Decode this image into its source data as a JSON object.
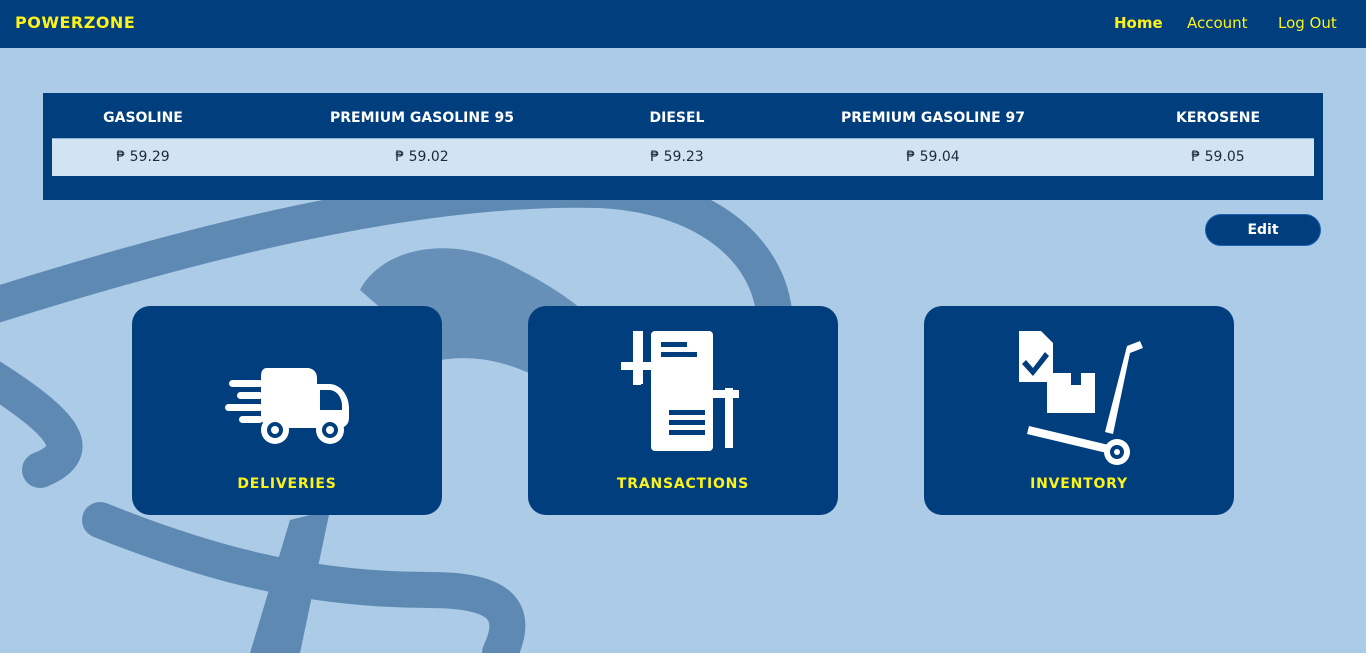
{
  "navbar": {
    "brand": "POWERZONE",
    "links": {
      "home": "Home",
      "account": "Account",
      "logout": "Log Out"
    }
  },
  "prices": {
    "headers": [
      "GASOLINE",
      "PREMIUM GASOLINE 95",
      "DIESEL",
      "PREMIUM GASOLINE 97",
      "KEROSENE"
    ],
    "values": [
      "₱ 59.29",
      "₱ 59.02",
      "₱ 59.23",
      "₱ 59.04",
      "₱ 59.05"
    ]
  },
  "edit_label": "Edit",
  "cards": {
    "deliveries": {
      "label": "DELIVERIES",
      "icon": "delivery-truck-icon"
    },
    "transactions": {
      "label": "TRANSACTIONS",
      "icon": "transfer-document-icon"
    },
    "inventory": {
      "label": "INVENTORY",
      "icon": "hand-truck-checklist-icon"
    }
  },
  "colors": {
    "primary": "#003e7e",
    "accent": "#fdf21a",
    "background": "#abcbe7",
    "watermark": "#5e89b2"
  }
}
